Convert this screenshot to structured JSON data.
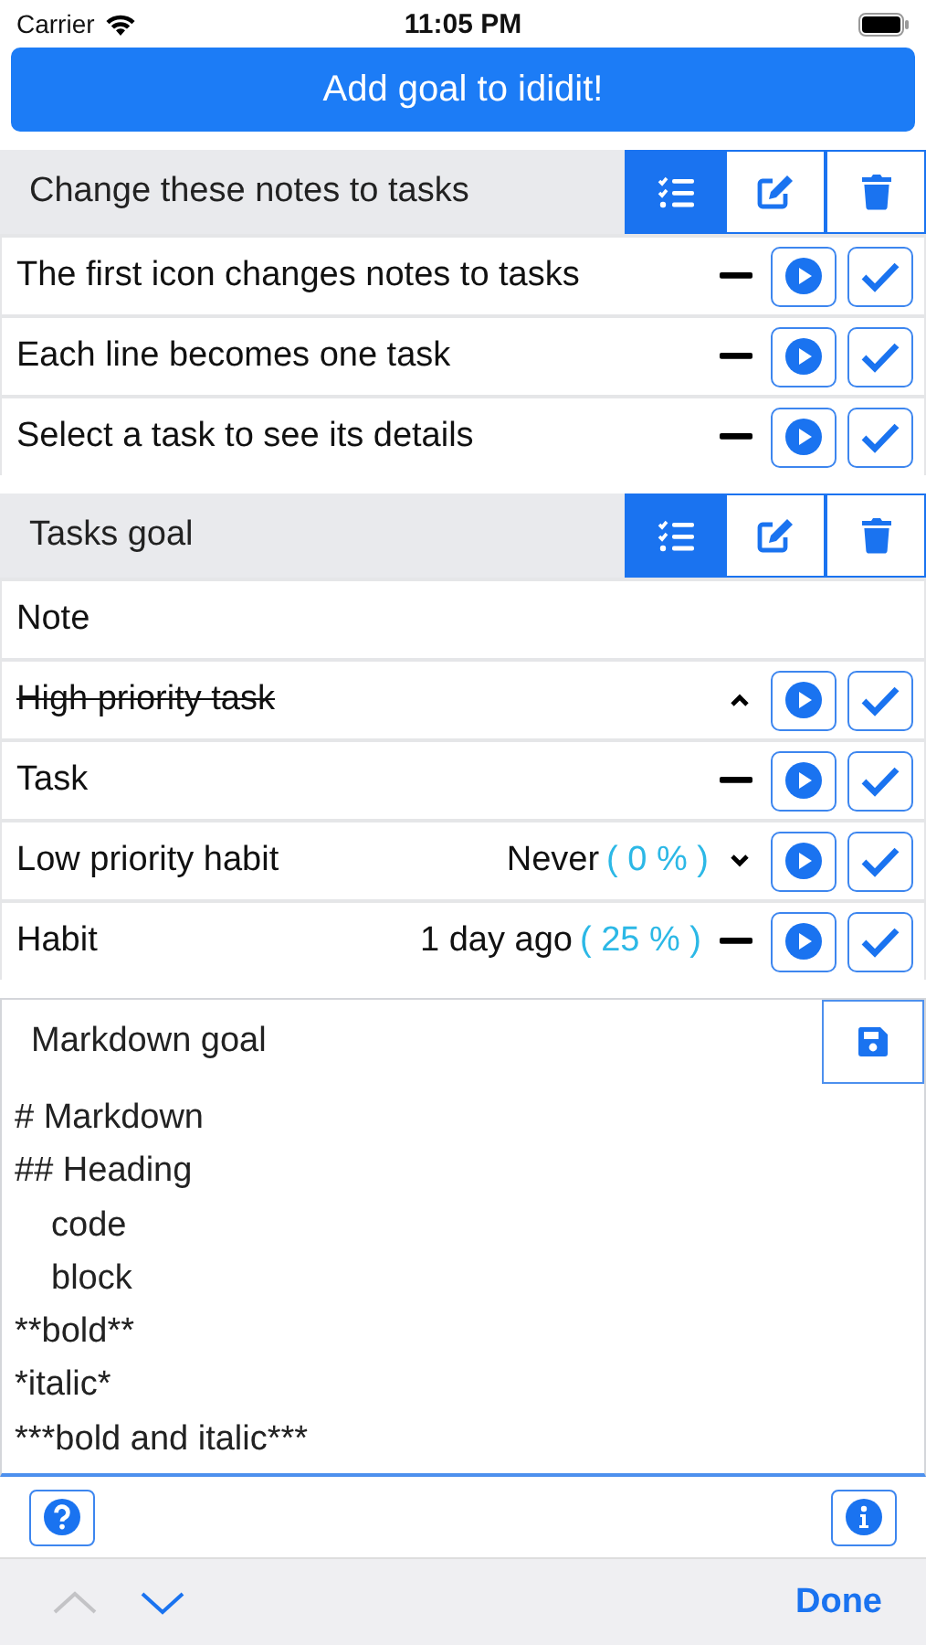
{
  "status_bar": {
    "carrier": "Carrier",
    "time": "11:05 PM"
  },
  "add_button": "Add goal to ididit!",
  "goals": [
    {
      "title": "Change these notes to tasks",
      "toolbar": [
        {
          "kind": "list",
          "selected": true
        },
        {
          "kind": "edit",
          "selected": false
        },
        {
          "kind": "delete",
          "selected": false
        }
      ],
      "items": [
        {
          "kind": "normal",
          "text": "The first icon changes notes to tasks",
          "done": false
        },
        {
          "kind": "normal",
          "text": "Each line becomes one task",
          "done": false
        },
        {
          "kind": "normal",
          "text": "Select a task to see its details",
          "done": false
        }
      ]
    },
    {
      "title": "Tasks goal",
      "toolbar": [
        {
          "kind": "list",
          "selected": true
        },
        {
          "kind": "edit",
          "selected": false
        },
        {
          "kind": "delete",
          "selected": false
        }
      ],
      "items": [
        {
          "kind": "note",
          "text": "Note"
        },
        {
          "kind": "high",
          "text": "High priority task",
          "done": true
        },
        {
          "kind": "normal",
          "text": "Task",
          "done": false
        },
        {
          "kind": "low",
          "text": "Low priority habit",
          "done": false,
          "last_done": "Never",
          "percent": "( 0 % )"
        },
        {
          "kind": "normal",
          "text": "Habit",
          "done": false,
          "last_done": "1 day ago",
          "percent": "( 25 % )"
        }
      ]
    }
  ],
  "markdown": {
    "title": "Markdown goal",
    "lines": [
      {
        "text": "# Markdown",
        "indent": false
      },
      {
        "text": "## Heading",
        "indent": false
      },
      {
        "text": "code",
        "indent": true
      },
      {
        "text": "block",
        "indent": true
      },
      {
        "text": "**bold**",
        "indent": false
      },
      {
        "text": "*italic*",
        "indent": false
      },
      {
        "text": "***bold and italic***",
        "indent": false
      }
    ]
  },
  "keyboard_toolbar": {
    "previous_disabled": true,
    "next_disabled": false,
    "done": "Done"
  }
}
